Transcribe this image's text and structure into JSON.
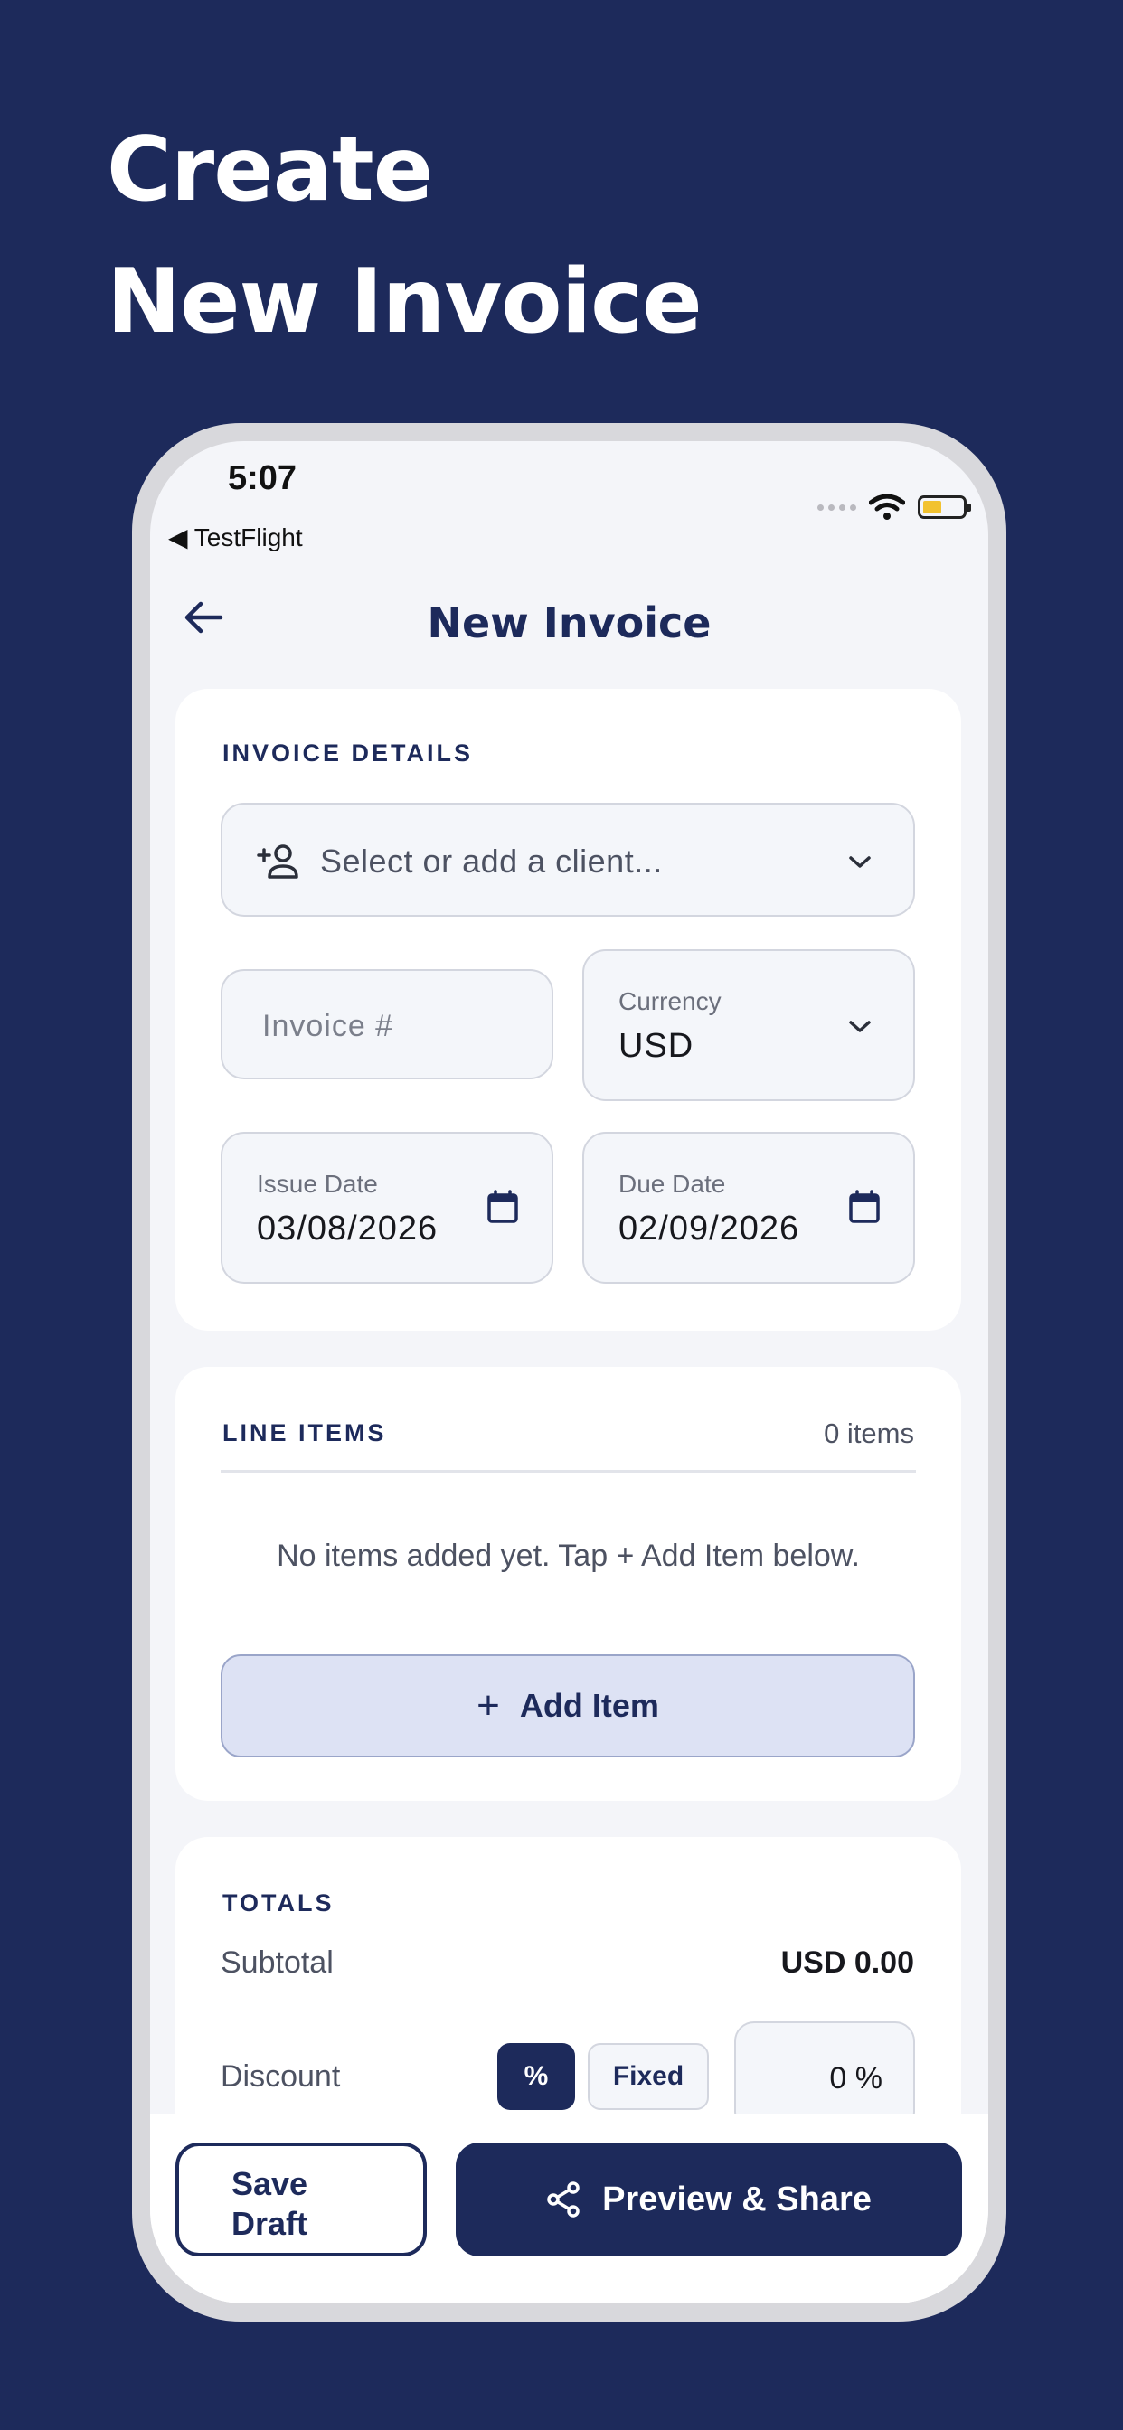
{
  "hero": {
    "line1": "Create",
    "line2": "New Invoice"
  },
  "status_bar": {
    "time": "5:07",
    "back_app": "◀ TestFlight"
  },
  "nav": {
    "title": "New Invoice"
  },
  "invoice_details": {
    "label": "INVOICE DETAILS",
    "client_placeholder": "Select or add a client...",
    "invoice_number_placeholder": "Invoice #",
    "currency_label": "Currency",
    "currency_value": "USD",
    "issue_date_label": "Issue Date",
    "issue_date_value": "03/08/2026",
    "due_date_label": "Due Date",
    "due_date_value": "02/09/2026"
  },
  "line_items": {
    "label": "LINE ITEMS",
    "count": "0 items",
    "empty_message": "No items added yet. Tap + Add Item below.",
    "add_button": "Add Item"
  },
  "totals": {
    "label": "TOTALS",
    "subtotal_label": "Subtotal",
    "subtotal_value": "USD 0.00",
    "discount_label": "Discount",
    "percent_option": "%",
    "fixed_option": "Fixed",
    "discount_value": "0 %"
  },
  "actions": {
    "save_line1": "Save",
    "save_line2": "Draft",
    "preview": "Preview & Share"
  },
  "colors": {
    "brand_navy": "#1d2a5b",
    "accent_light": "#dde2f4"
  },
  "icons": [
    "back-arrow-icon",
    "add-person-icon",
    "chevron-down-icon",
    "calendar-icon",
    "plus-icon",
    "share-icon",
    "wifi-icon",
    "battery-icon"
  ]
}
